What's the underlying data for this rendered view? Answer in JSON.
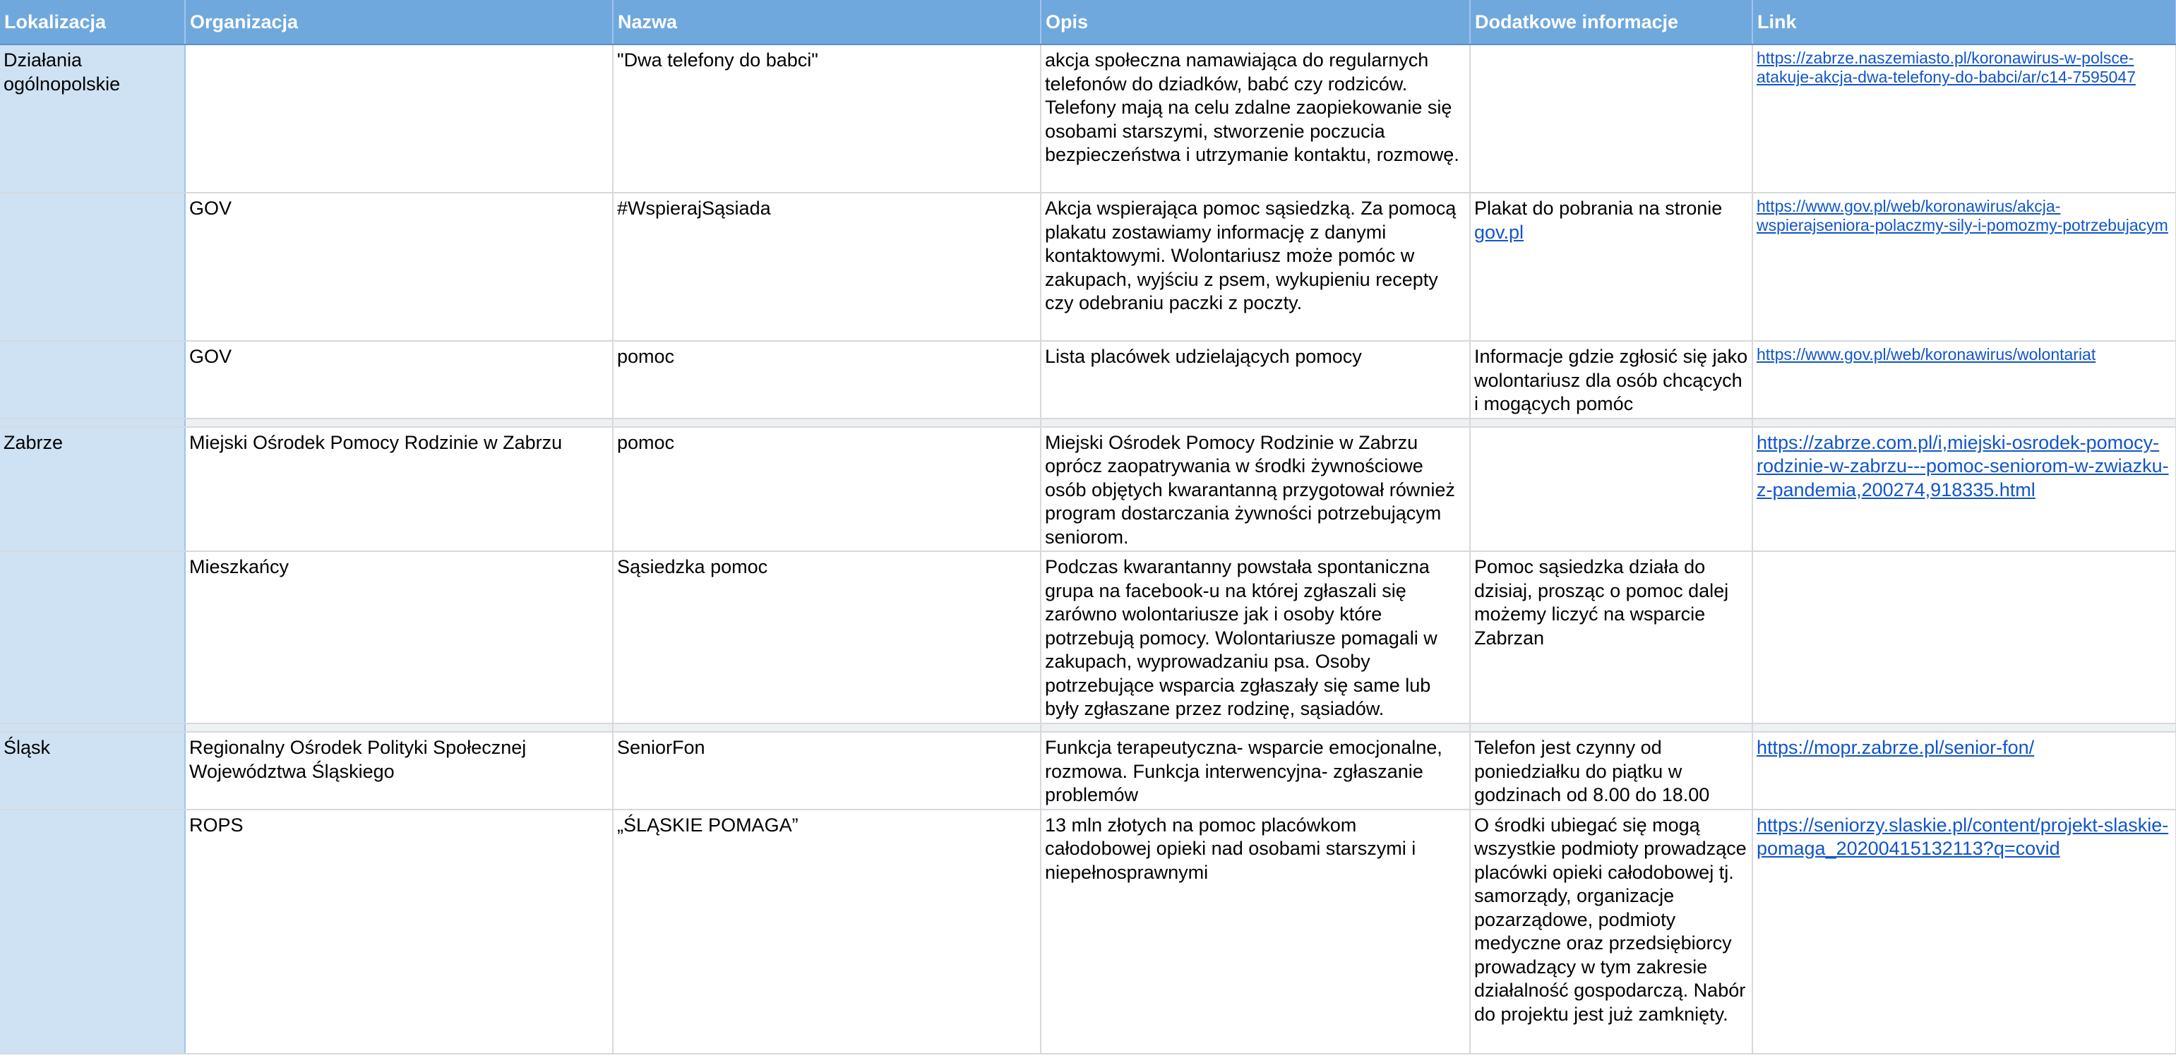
{
  "headers": [
    "Lokalizacja",
    "Organizacja",
    "Nazwa",
    "Opis",
    "Dodatkowe informacje",
    "Link"
  ],
  "rows": [
    {
      "lok": "Działania ogólnopolskie",
      "org": "",
      "nazwa": "\"Dwa telefony do babci\"",
      "opis": "akcja społeczna namawiająca do regularnych telefonów do dziadków, babć czy rodziców. Telefony mają na celu zdalne zaopiekowanie się osobami starszymi, stworzenie poczucia bezpieczeństwa i utrzymanie kontaktu, rozmowę.",
      "info": "",
      "info_link": "",
      "link": "https://zabrze.naszemiasto.pl/koronawirus-w-polsce-atakuje-akcja-dwa-telefony-do-babci/ar/c14-7595047"
    },
    {
      "lok": "",
      "org": "GOV",
      "nazwa": "#WspierajSąsiada",
      "opis": "Akcja wspierająca pomoc sąsiedzką. Za pomocą plakatu zostawiamy informację z danymi kontaktowymi. Wolontariusz może pomóc w zakupach, wyjściu z psem, wykupieniu recepty czy odebraniu paczki z poczty.",
      "info": "Plakat do pobrania na stronie",
      "info_link": "gov.pl",
      "link": "https://www.gov.pl/web/koronawirus/akcja-wspierajseniora-polaczmy-sily-i-pomozmy-potrzebujacym"
    },
    {
      "lok": "",
      "org": "GOV",
      "nazwa": "pomoc",
      "opis": "Lista placówek udzielających pomocy",
      "info": "Informacje gdzie zgłosić się jako wolontariusz dla osób chcących i mogących pomóc",
      "info_link": "",
      "link": "https://www.gov.pl/web/koronawirus/wolontariat"
    },
    {
      "lok": "Zabrze",
      "org": "Miejski Ośrodek Pomocy Rodzinie w Zabrzu",
      "nazwa": "pomoc",
      "opis": "Miejski Ośrodek Pomocy Rodzinie w Zabrzu oprócz zaopatrywania w środki żywnościowe osób objętych kwarantanną przygotował również program dostarczania żywności potrzebującym seniorom.",
      "info": "",
      "info_link": "",
      "link": "https://zabrze.com.pl/i,miejski-osrodek-pomocy-rodzinie-w-zabrzu---pomoc-seniorom-w-zwiazku-z-pandemia,200274,918335.html"
    },
    {
      "lok": "",
      "org": "Mieszkańcy",
      "nazwa": "Sąsiedzka pomoc",
      "opis": "Podczas kwarantanny powstała spontaniczna grupa na facebook-u na której zgłaszali się zarówno wolontariusze jak i osoby które potrzebują pomocy. Wolontariusze pomagali w zakupach, wyprowadzaniu psa. Osoby potrzebujące wsparcia zgłaszały się same lub były zgłaszane przez rodzinę, sąsiadów.",
      "info": "Pomoc sąsiedzka działa do dzisiaj, prosząc o pomoc dalej możemy liczyć na wsparcie Zabrzan",
      "info_link": "",
      "link": ""
    },
    {
      "lok": "Śląsk",
      "org": "Regionalny Ośrodek Polityki Społecznej Województwa Śląskiego",
      "nazwa": "SeniorFon",
      "opis": "Funkcja terapeutyczna- wsparcie emocjonalne, rozmowa. Funkcja interwencyjna- zgłaszanie problemów",
      "info": "Telefon jest czynny od poniedziałku do piątku w godzinach od 8.00 do 18.00",
      "info_link": "",
      "link": "https://mopr.zabrze.pl/senior-fon/"
    },
    {
      "lok": "",
      "org": "ROPS",
      "nazwa": "„ŚLĄSKIE POMAGA”",
      "opis": "13 mln złotych na pomoc placówkom całodobowej opieki nad osobami starszymi i niepełnosprawnymi",
      "info": "O środki ubiegać się mogą wszystkie podmioty prowadzące placówki opieki całodobowej tj. samorządy, organizacje pozarządowe, podmioty medyczne oraz przedsiębiorcy prowadzący w tym zakresie działalność gospodarczą. Nabór do projektu jest już zamknięty.",
      "info_link": "",
      "link": "https://seniorzy.slaskie.pl/content/projekt-slaskie-pomaga_20200415132113?q=covid"
    }
  ]
}
